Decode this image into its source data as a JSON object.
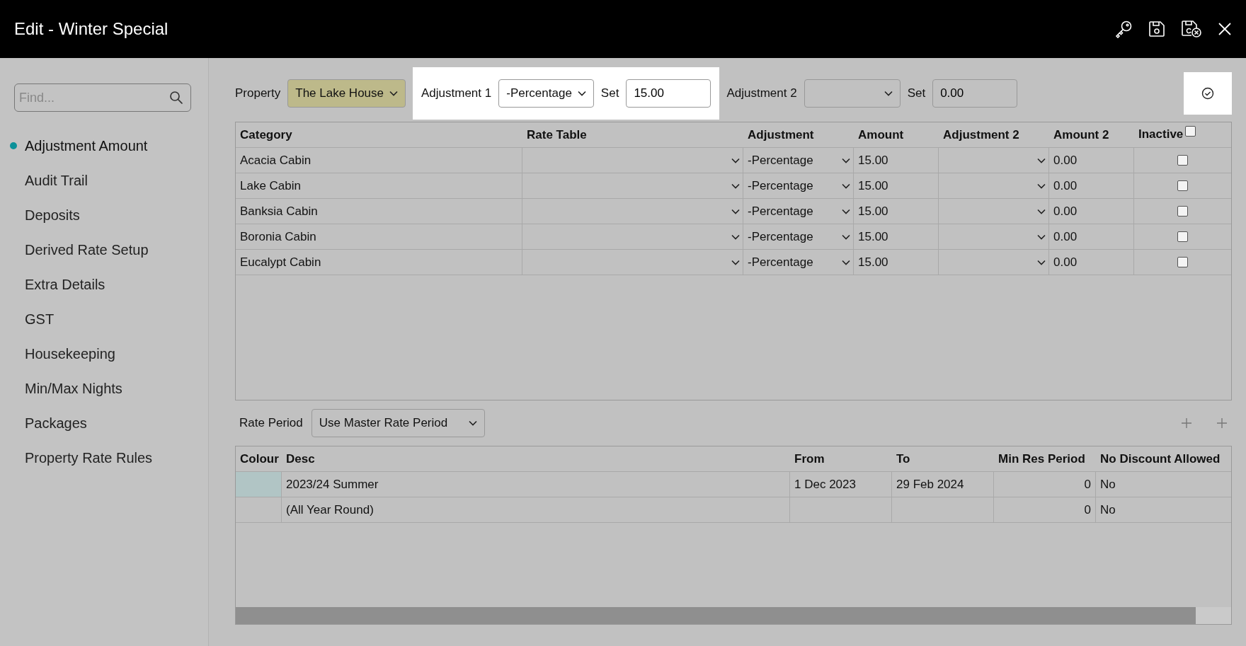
{
  "window": {
    "title": "Edit - Winter Special"
  },
  "search": {
    "placeholder": "Find..."
  },
  "sidebar": {
    "items": [
      {
        "label": "Adjustment Amount",
        "selected": true
      },
      {
        "label": "Audit Trail",
        "selected": false
      },
      {
        "label": "Deposits",
        "selected": false
      },
      {
        "label": "Derived Rate Setup",
        "selected": false
      },
      {
        "label": "Extra Details",
        "selected": false
      },
      {
        "label": "GST",
        "selected": false
      },
      {
        "label": "Housekeeping",
        "selected": false
      },
      {
        "label": "Min/Max Nights",
        "selected": false
      },
      {
        "label": "Packages",
        "selected": false
      },
      {
        "label": "Property Rate Rules",
        "selected": false
      }
    ]
  },
  "toolbar": {
    "property_label": "Property",
    "property_value": "The Lake House",
    "adjustment1_label": "Adjustment 1",
    "adjustment1_value": "-Percentage",
    "set1_label": "Set",
    "set1_value": "15.00",
    "adjustment2_label": "Adjustment 2",
    "set2_label": "Set",
    "set2_value": "0.00"
  },
  "categories": {
    "columns": [
      "Category",
      "Rate Table",
      "Adjustment",
      "Amount",
      "Adjustment 2",
      "Amount 2",
      "Inactive"
    ],
    "header_checked": false,
    "rows": [
      {
        "category": "Acacia Cabin",
        "adjustment": "-Percentage",
        "amount": "15.00",
        "amount2": "0.00",
        "inactive": false
      },
      {
        "category": "Lake Cabin",
        "adjustment": "-Percentage",
        "amount": "15.00",
        "amount2": "0.00",
        "inactive": false
      },
      {
        "category": "Banksia Cabin",
        "adjustment": "-Percentage",
        "amount": "15.00",
        "amount2": "0.00",
        "inactive": false
      },
      {
        "category": "Boronia Cabin",
        "adjustment": "-Percentage",
        "amount": "15.00",
        "amount2": "0.00",
        "inactive": false
      },
      {
        "category": "Eucalypt Cabin",
        "adjustment": "-Percentage",
        "amount": "15.00",
        "amount2": "0.00",
        "inactive": false
      }
    ]
  },
  "rate_period": {
    "label": "Rate Period",
    "value": "Use Master Rate Period"
  },
  "periods": {
    "columns": [
      "Colour",
      "Desc",
      "From",
      "To",
      "Min Res Period",
      "No Discount Allowed"
    ],
    "rows": [
      {
        "color": "#b1c5c5",
        "desc": "2023/24 Summer",
        "from": "1 Dec 2023",
        "to": "29 Feb 2024",
        "min_res": "0",
        "no_discount": "No"
      },
      {
        "desc": "(All Year Round)",
        "min_res": "0",
        "no_discount": "No"
      }
    ]
  }
}
